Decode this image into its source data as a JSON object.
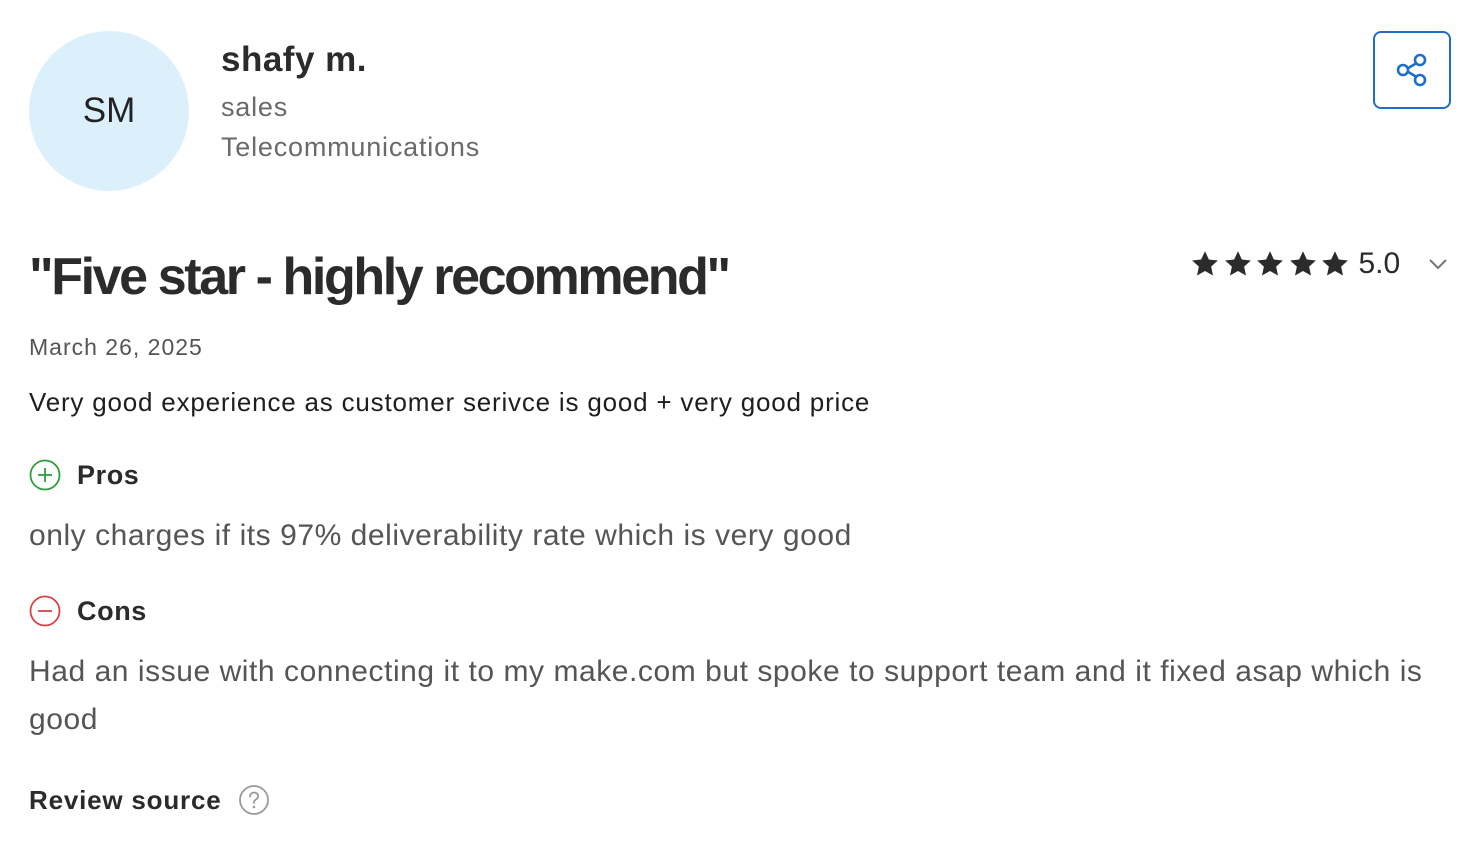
{
  "reviewer": {
    "initials": "SM",
    "name": "shafy m.",
    "role": "sales",
    "industry": "Telecommunications"
  },
  "review": {
    "title": "\"Five star - highly recommend\"",
    "rating": 5.0,
    "rating_label": "5.0",
    "stars_total": 5,
    "date": "March 26, 2025",
    "summary": "Very good experience as customer serivce is good + very good price",
    "pros_label": "Pros",
    "pros_text": "only charges if its 97% deliverability rate which is very good",
    "cons_label": "Cons",
    "cons_text": "Had an issue with connecting it to my make.com but spoke to support team and it fixed asap which is good",
    "source_label": "Review source"
  },
  "icons": {
    "share": "share-icon",
    "star": "star-icon",
    "expand": "chevron-down-icon",
    "pros": "plus-circle-icon",
    "cons": "minus-circle-icon",
    "help": "question-circle-icon"
  },
  "colors": {
    "avatar_bg": "#dcf0fc",
    "accent": "#1f6fc9",
    "pros": "#2e9e3a",
    "cons": "#d64545",
    "star": "#2b2b2b"
  }
}
